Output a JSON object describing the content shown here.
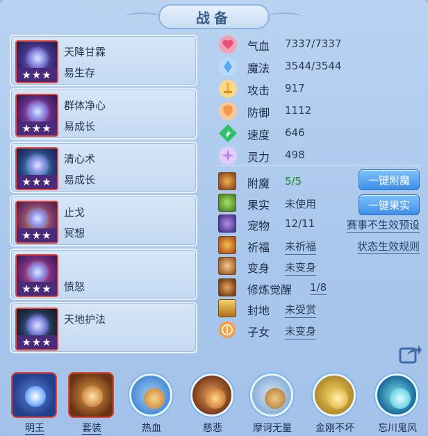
{
  "title": "战备",
  "skills": [
    {
      "name": "天降甘霖",
      "desc": "易生存",
      "stars": "★★★"
    },
    {
      "name": "群体净心",
      "desc": "易成长",
      "stars": "★★★"
    },
    {
      "name": "清心术",
      "desc": "易成长",
      "stars": "★★★"
    },
    {
      "name": "止戈",
      "desc": "冥想",
      "stars": "★★★"
    },
    {
      "name": "",
      "desc": "愤怒",
      "stars": "★★★"
    },
    {
      "name": "天地护法",
      "desc": "",
      "stars": "★★★"
    }
  ],
  "stats": [
    {
      "label": "气血",
      "value": "7337/7337",
      "icon": "heart-icon",
      "color": "#e8507a"
    },
    {
      "label": "魔法",
      "value": "3544/3544",
      "icon": "mana-icon",
      "color": "#5aa6f2"
    },
    {
      "label": "攻击",
      "value": "917",
      "icon": "sword-icon",
      "color": "#f2b63c"
    },
    {
      "label": "防御",
      "value": "1112",
      "icon": "shield-icon",
      "color": "#f29a4a"
    },
    {
      "label": "速度",
      "value": "646",
      "icon": "speed-icon",
      "color": "#2fbf6a"
    },
    {
      "label": "灵力",
      "value": "498",
      "icon": "spirit-icon",
      "color": "#b98ae8"
    }
  ],
  "extras": [
    {
      "label": "附魔",
      "value": "5/5",
      "icon": "enchant-icon"
    },
    {
      "label": "果实",
      "value": "未使用",
      "icon": "fruit-icon"
    },
    {
      "label": "宠物",
      "value": "12/11",
      "icon": "pet-icon"
    },
    {
      "label": "祈福",
      "value": "未祈福",
      "icon": "blessing-icon"
    },
    {
      "label": "变身",
      "value": "未变身",
      "icon": "transform-icon"
    },
    {
      "label": "修炼觉醒",
      "value": "1/8",
      "icon": "cultivation-icon"
    },
    {
      "label": "封地",
      "value": "未受赏",
      "icon": "fief-icon"
    },
    {
      "label": "子女",
      "value": "未变身",
      "icon": "child-icon"
    }
  ],
  "buttons": {
    "enchant_all": "一键附魔",
    "fruit_all": "一键果实"
  },
  "links": {
    "event_preset": "赛事不生效预设",
    "status_rules": "状态生效规则"
  },
  "bottom": [
    {
      "label": "明王",
      "shape": "square"
    },
    {
      "label": "套装",
      "shape": "square"
    },
    {
      "label": "热血",
      "shape": "circle"
    },
    {
      "label": "慈悲",
      "shape": "circle"
    },
    {
      "label": "摩诃无量",
      "shape": "circle"
    },
    {
      "label": "金刚不坏",
      "shape": "circle"
    },
    {
      "label": "忘川鬼风",
      "shape": "circle"
    }
  ],
  "colors": {
    "accent": "#3e8ee8",
    "frame_red": "#e0453a",
    "green_value": "#1a8a1a"
  }
}
